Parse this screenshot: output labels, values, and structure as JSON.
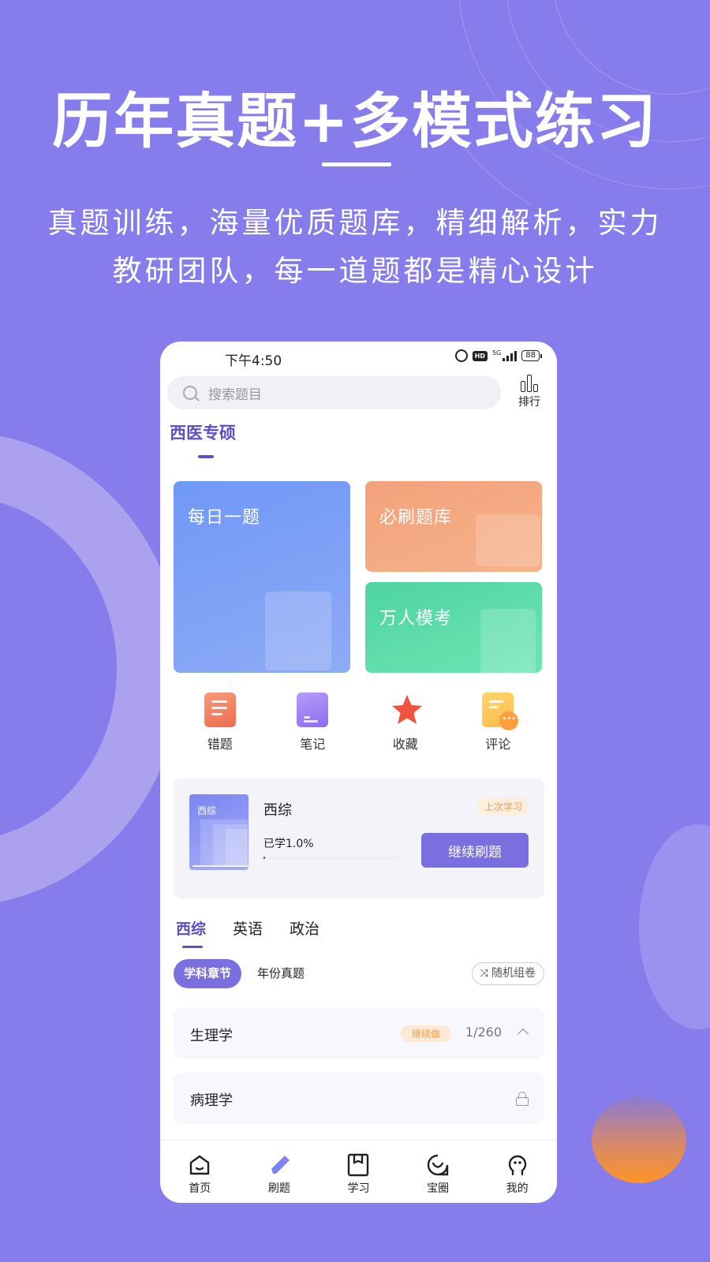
{
  "promo": {
    "headline": "历年真题+多模式练习",
    "subline_1": "真题训练，海量优质题库，精细解析，实力",
    "subline_2": "教研团队，每一道题都是精心设计"
  },
  "status_bar": {
    "time": "下午4:50",
    "network": "5G",
    "hd": "HD",
    "battery": "88"
  },
  "search": {
    "placeholder": "搜索题目"
  },
  "rank": {
    "label": "排行"
  },
  "category": {
    "title": "西医专硕"
  },
  "feature_cards": [
    {
      "label": "每日一题",
      "color": "#7a9ff6"
    },
    {
      "label": "必刷题库",
      "color": "#f5a980"
    },
    {
      "label": "万人模考",
      "color": "#5cdcaa"
    }
  ],
  "quick_actions": [
    {
      "label": "错题",
      "icon": "wrong-questions-icon"
    },
    {
      "label": "笔记",
      "icon": "notes-icon"
    },
    {
      "label": "收藏",
      "icon": "star-icon"
    },
    {
      "label": "评论",
      "icon": "comment-icon"
    }
  ],
  "progress_card": {
    "cover_label": "西综",
    "title": "西综",
    "learned_text": "已学1.0%",
    "progress_percent": 1.0,
    "badge": "上次学习",
    "button": "继续刷题"
  },
  "subject_tabs": [
    {
      "label": "西综",
      "active": true
    },
    {
      "label": "英语",
      "active": false
    },
    {
      "label": "政治",
      "active": false
    }
  ],
  "modes": {
    "active": "学科章节",
    "other": "年份真题",
    "random": "随机组卷"
  },
  "chapters": [
    {
      "name": "生理学",
      "badge": "继续做",
      "count": "1/260",
      "state": "expanded"
    },
    {
      "name": "病理学",
      "state": "locked"
    }
  ],
  "tabbar": [
    {
      "label": "首页",
      "icon": "home-icon"
    },
    {
      "label": "刷题",
      "icon": "pencil-icon",
      "active": true
    },
    {
      "label": "学习",
      "icon": "book-icon"
    },
    {
      "label": "宝圈",
      "icon": "smile-chat-icon"
    },
    {
      "label": "我的",
      "icon": "profile-icon"
    }
  ],
  "colors": {
    "background": "#877ceb",
    "accent": "#7b6fe0",
    "accent_text": "#5b4fc4",
    "badge_orange": "#f29a4b"
  }
}
